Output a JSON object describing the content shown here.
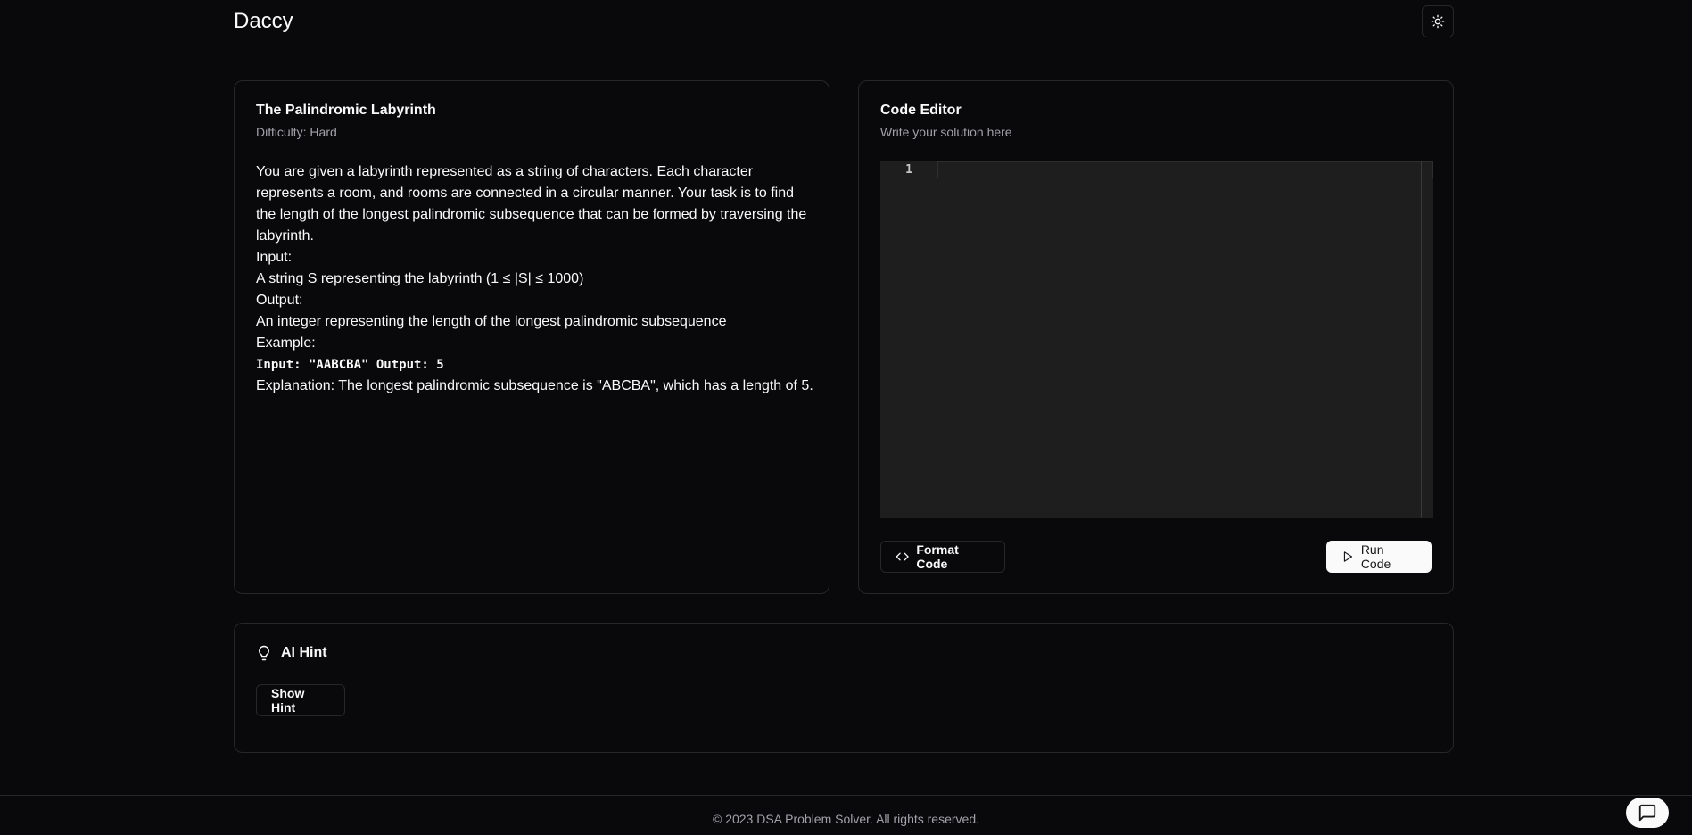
{
  "header": {
    "brand": "Daccy",
    "theme_icon": "sun-icon"
  },
  "problem": {
    "title": "The Palindromic Labyrinth",
    "difficulty": "Difficulty: Hard",
    "description": "You are given a labyrinth represented as a string of characters. Each character represents a room, and rooms are connected in a circular manner. Your task is to find the length of the longest palindromic subsequence that can be formed by traversing the labyrinth.",
    "input_label": "Input:",
    "input_text": "A string S representing the labyrinth (1 ≤ |S| ≤ 1000)",
    "output_label": "Output:",
    "output_text": "An integer representing the length of the longest palindromic subsequence",
    "example_label": "Example:",
    "example_code": "Input: \"AABCBA\" Output: 5",
    "explanation": "Explanation: The longest palindromic subsequence is \"ABCBA\", which has a length of 5."
  },
  "editor": {
    "title": "Code Editor",
    "subtitle": "Write your solution here",
    "line_number": "1",
    "format_label": "Format Code",
    "format_icon": "code-icon",
    "run_label": "Run Code",
    "run_icon": "play-icon"
  },
  "hint": {
    "title": "AI Hint",
    "icon": "lightbulb-icon",
    "button_label": "Show Hint"
  },
  "footer": {
    "text": "© 2023 DSA Problem Solver. All rights reserved.",
    "chat_icon": "chat-icon"
  }
}
